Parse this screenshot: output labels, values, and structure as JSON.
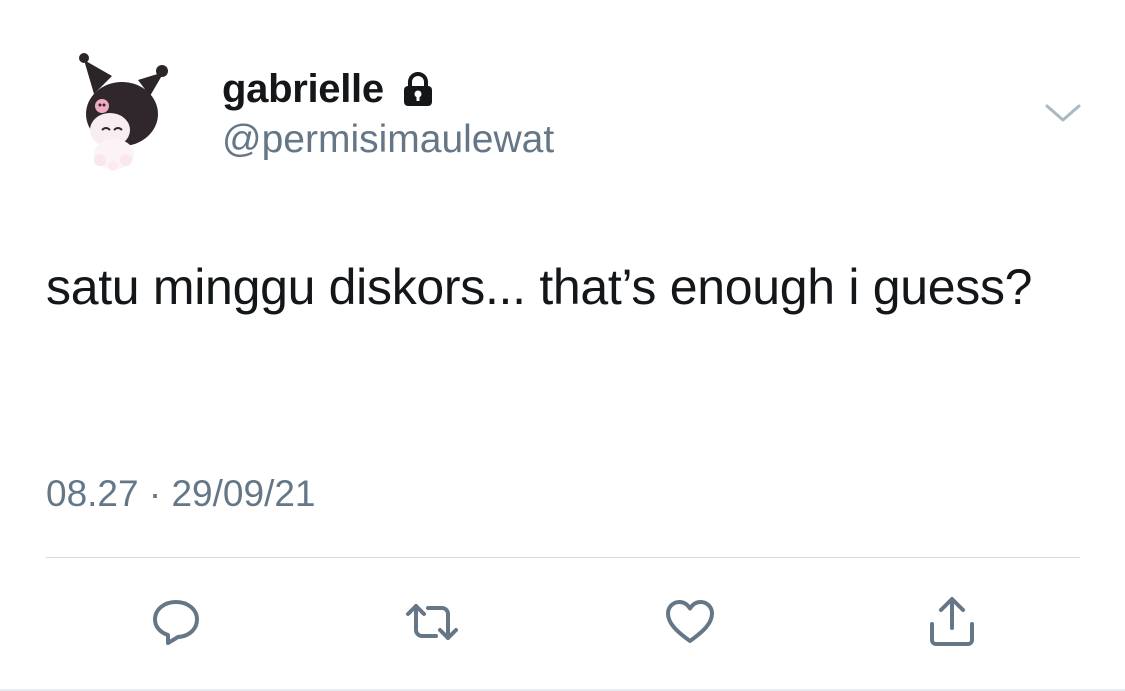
{
  "tweet": {
    "display_name": "gabrielle",
    "handle": "@permisimaulewat",
    "protected": true,
    "text": "satu minggu diskors... that’s enough i guess?",
    "time": "08.27",
    "separator": "·",
    "date": "29/09/21"
  },
  "icons": {
    "lock": "lock-icon",
    "more": "chevron-down-icon",
    "reply": "reply-icon",
    "retweet": "retweet-icon",
    "like": "heart-icon",
    "share": "share-icon"
  },
  "colors": {
    "text": "#14171a",
    "secondary": "#657786",
    "divider": "#d6dbe0"
  }
}
